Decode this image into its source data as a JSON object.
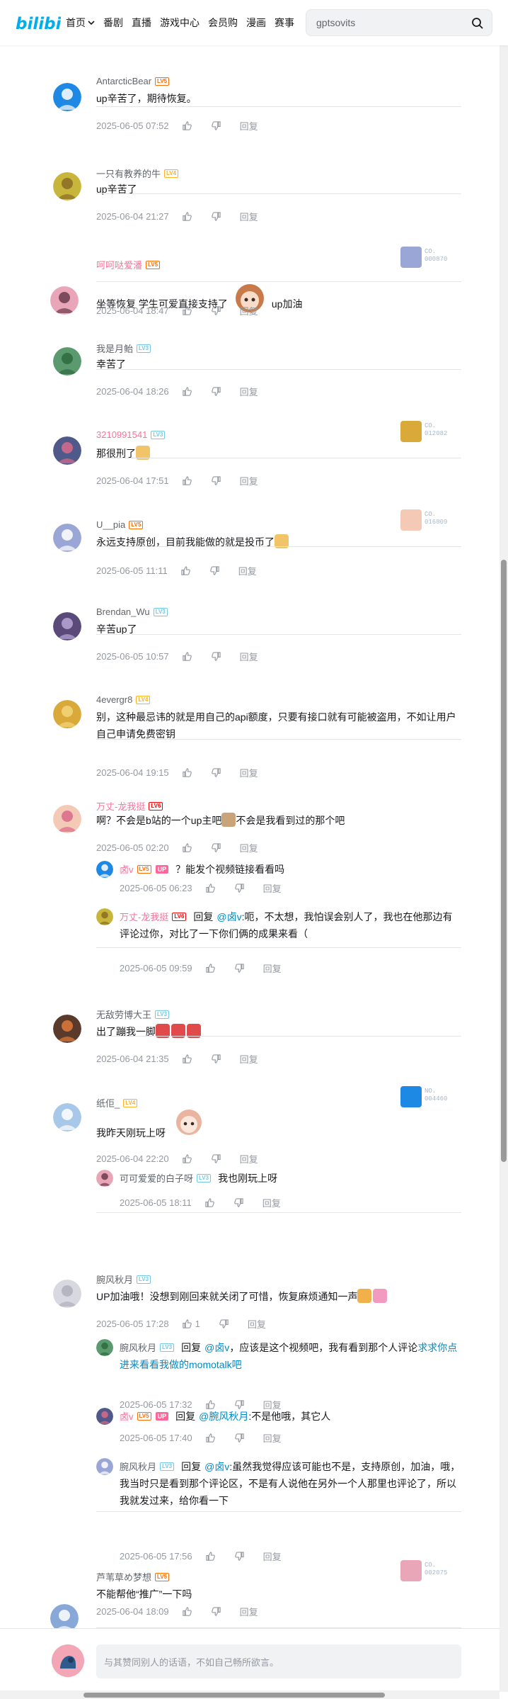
{
  "header": {
    "nav": [
      "首页",
      "番剧",
      "直播",
      "游戏中心",
      "会员购",
      "漫画",
      "赛事"
    ],
    "search_value": "gptsovits"
  },
  "labels": {
    "reply": "回复",
    "reply_prefix": "回复",
    "up_badge": "UP"
  },
  "comments": [
    {
      "user": "AntarcticBear",
      "level": "LV5",
      "name_color": "#61666d",
      "text": "up辛苦了，期待恢复。",
      "time": "2025-06-05 07:52"
    },
    {
      "user": "一只有教养的牛",
      "level": "LV4",
      "name_color": "#61666d",
      "text": "up辛苦了",
      "time": "2025-06-04 21:27"
    },
    {
      "user": "呵呵哒爱潘",
      "level": "LV5",
      "name_color": "#fb7299",
      "text_before": "坐等恢复 学生可爱直接支持了",
      "text_after": "up加油",
      "time": "2025-06-04 18:47",
      "badge": "CO.\n000870"
    },
    {
      "user": "我是月鲐",
      "level": "LV3",
      "name_color": "#61666d",
      "text": "幸苦了",
      "time": "2025-06-04 18:26"
    },
    {
      "user": "3210991541",
      "level": "LV3",
      "name_color": "#fb7299",
      "text": "那很刑了",
      "time": "2025-06-04 17:51",
      "badge": "CO.\n012082"
    },
    {
      "user": "U__pia",
      "level": "LV5",
      "name_color": "#61666d",
      "text": "永远支持原创，目前我能做的就是投币了",
      "time": "2025-06-05 11:11",
      "badge": "CO.\n016809"
    },
    {
      "user": "Brendan_Wu",
      "level": "LV3",
      "name_color": "#61666d",
      "text": "辛苦up了",
      "time": "2025-06-05 10:57"
    },
    {
      "user": "4evergr8",
      "level": "LV4",
      "name_color": "#61666d",
      "text": "别，这种最忌讳的就是用自己的api额度，只要有接口就有可能被盗用，不如让用户自己申请免费密钥",
      "time": "2025-06-04 19:15"
    },
    {
      "user": "万丈-龙我挺",
      "level": "LV6",
      "name_color": "#fb7299",
      "text": "啊？不会是b站的一个up主吧",
      "text_after": "不会是我看到过的那个吧",
      "time": "2025-06-05 02:20",
      "replies": [
        {
          "user": "卤v",
          "level": "LV5",
          "name_color": "#fb7299",
          "is_up": true,
          "text": "？能发个视频链接看看吗",
          "time": "2025-06-05 06:23"
        },
        {
          "user": "万丈-龙我挺",
          "level": "LV6",
          "name_color": "#fb7299",
          "reply_to": "@卤v",
          "text": ":呃，不太想，我怕误会别人了，我也在他那边有评论过你，对比了一下你们俩的成果来看（",
          "time": "2025-06-05 09:59"
        }
      ]
    },
    {
      "user": "无敌劳博大王",
      "level": "LV3",
      "name_color": "#61666d",
      "text": "出了蹦我一脚",
      "time": "2025-06-04 21:35"
    },
    {
      "user": "纸佢_",
      "level": "LV4",
      "name_color": "#61666d",
      "text": "我昨天刚玩上呀",
      "time": "2025-06-04 22:20",
      "badge": "NO.\n004460",
      "replies": [
        {
          "user": "可可爱爱的白子呀",
          "level": "LV3",
          "name_color": "#61666d",
          "text": "我也刚玩上呀",
          "time": "2025-06-05 18:11"
        }
      ]
    },
    {
      "user": "腕风秋月",
      "level": "LV3",
      "name_color": "#61666d",
      "text": "UP加油哦！没想到刚回来就关闭了可惜，恢复麻烦通知一声",
      "time": "2025-06-05 17:28",
      "likes": "1",
      "replies": [
        {
          "user": "腕风秋月",
          "level": "LV3",
          "name_color": "#61666d",
          "reply_to": "@卤v",
          "text": "，应该是这个视频吧，我有看到那个人评论",
          "link": "求求你点进来看看我做的momotalk吧",
          "time": "2025-06-05 17:32"
        },
        {
          "user": "卤v",
          "level": "LV5",
          "name_color": "#fb7299",
          "is_up": true,
          "reply_to": "@腕风秋月",
          "text": ":不是他哦，其它人",
          "time": "2025-06-05 17:40"
        },
        {
          "user": "腕风秋月",
          "level": "LV3",
          "name_color": "#61666d",
          "reply_to": "@卤v",
          "text": ":虽然我觉得应该可能也不是，支持原创，加油，哦，我当时只是看到那个评论区，不是有人说他在另外一个人那里也评论了，所以我就发过来，给你看一下",
          "time": "2025-06-05 17:56"
        }
      ]
    },
    {
      "user": "芦苇草め梦想",
      "level": "LV5",
      "name_color": "#61666d",
      "text": "不能帮他“推广”一下吗",
      "time": "2025-06-04 18:09",
      "badge": "CO.\n002075"
    }
  ],
  "composer": {
    "placeholder": "与其赞同别人的话语，不如自己畅所欲言。"
  },
  "icons": [
    "bilibili-logo",
    "chevron-down-icon",
    "search-icon",
    "thumbs-up-icon",
    "thumbs-down-icon",
    "emoji-icon",
    "sticker-icon"
  ],
  "colors": {
    "brand": "#00aeec",
    "pink": "#fb7299",
    "link": "#008ac5",
    "muted": "#9499a0"
  }
}
